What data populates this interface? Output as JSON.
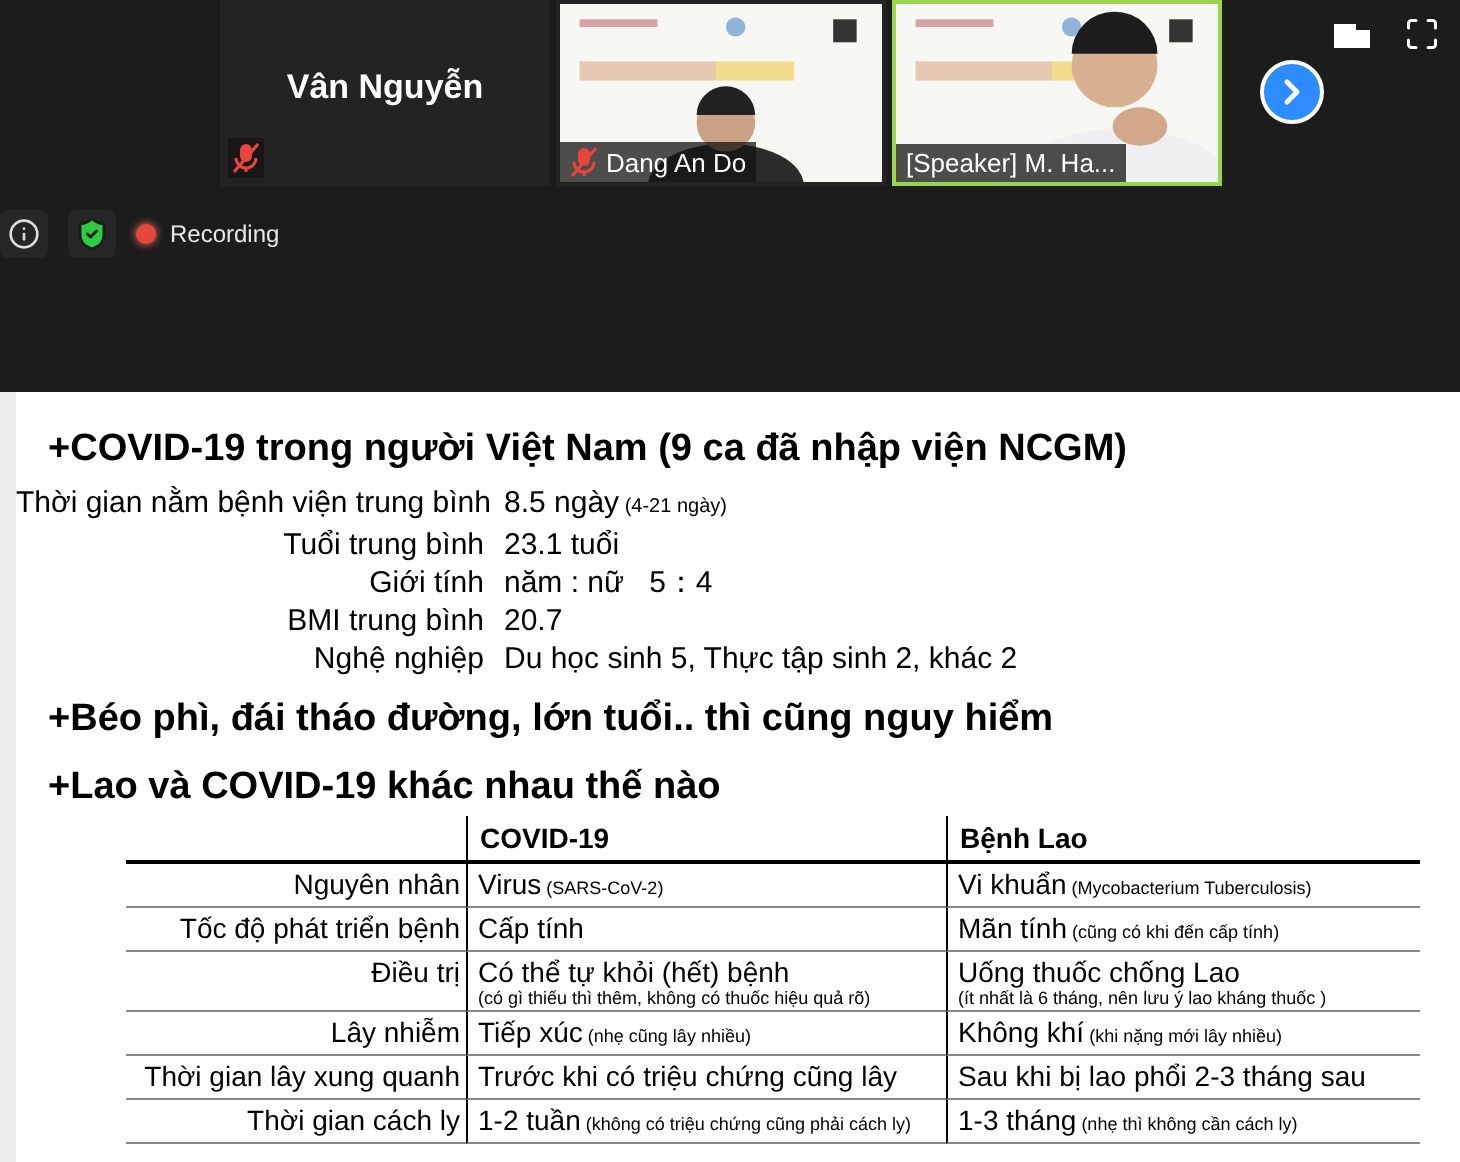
{
  "meeting": {
    "tiles": [
      {
        "kind": "avatar",
        "name": "Vân Nguyễn",
        "muted": true,
        "active": false
      },
      {
        "kind": "video",
        "name": "Dang An Do",
        "muted": true,
        "active": false
      },
      {
        "kind": "video",
        "name": "[Speaker] M. Ha...",
        "muted": false,
        "active": true
      }
    ],
    "recording": {
      "label": "Recording",
      "on": true
    }
  },
  "slide": {
    "heading": "+COVID-19 trong người Việt Nam (9 ca đã nhập viện NCGM)",
    "stats": [
      {
        "label": "Thời gian nằm bệnh viện trung bình",
        "value": "8.5 ngày",
        "note": "(4-21 ngày)"
      },
      {
        "label": "Tuổi trung bình",
        "value": "23.1 tuổi"
      },
      {
        "label": "Giới tính",
        "value": "năm : nữ   5：4"
      },
      {
        "label": "BMI trung bình",
        "value": "20.7"
      },
      {
        "label": "Nghệ nghiệp",
        "value": "Du học sinh 5, Thực tập sinh 2, khác 2"
      }
    ],
    "headings": [
      "+Béo phì, đái tháo đường, lớn tuổi.. thì cũng nguy hiểm",
      "+Lao và COVID-19 khác nhau thế nào"
    ],
    "table": {
      "columns": [
        "COVID-19",
        "Bệnh Lao"
      ],
      "rows": [
        {
          "kind": "inline",
          "label": "Nguyên nhân",
          "cells": [
            {
              "text": "Virus",
              "note": "(SARS-CoV-2)"
            },
            {
              "text": "Vi khuẩn",
              "note": "(Mycobacterium Tuberculosis)"
            }
          ]
        },
        {
          "kind": "inline",
          "label": "Tốc độ phát triển bệnh",
          "cells": [
            {
              "text": "Cấp tính"
            },
            {
              "text": "Mãn tính",
              "note": "(cũng có khi đến cấp tính)"
            }
          ]
        },
        {
          "kind": "stacked",
          "label": "Điều trị",
          "cells": [
            {
              "text": "Có thể tự khỏi (hết) bệnh",
              "note": "(có gì thiếu thì thêm, không có thuốc hiệu quả rõ)"
            },
            {
              "text": "Uống thuốc chống Lao",
              "note": "(ít nhất là 6 tháng, nên lưu ý lao kháng thuốc )"
            }
          ]
        },
        {
          "kind": "inline",
          "label": "Lây nhiễm",
          "cells": [
            {
              "text": "Tiếp xúc",
              "note": "(nhẹ cũng lây nhiều)"
            },
            {
              "text": "Không khí",
              "note": "(khi nặng mới lây nhiều)"
            }
          ]
        },
        {
          "kind": "inline",
          "label": "Thời gian lây xung quanh",
          "cells": [
            {
              "text": "Trước khi có triệu chứng cũng lây"
            },
            {
              "text": "Sau khi bị lao phổi 2-3 tháng sau"
            }
          ]
        },
        {
          "kind": "inline",
          "label": "Thời gian cách ly",
          "cells": [
            {
              "text": "1-2 tuần",
              "note": "(không có triệu chứng cũng phải cách ly)"
            },
            {
              "text": "1-3 tháng",
              "note": "(nhẹ thì không cần cách ly)"
            }
          ]
        }
      ]
    }
  }
}
